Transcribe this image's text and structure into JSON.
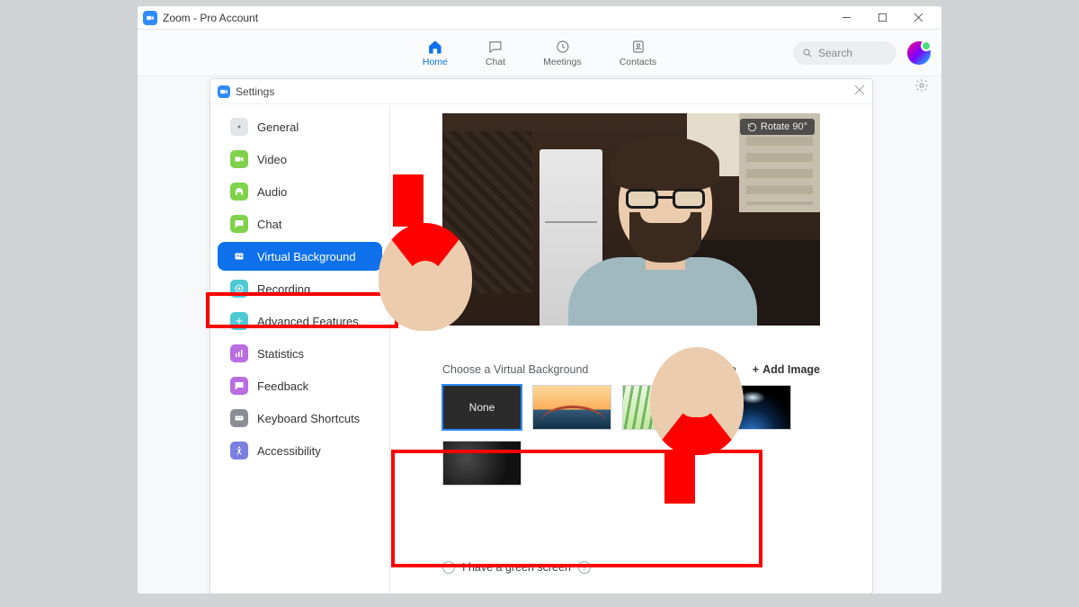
{
  "window": {
    "title": "Zoom - Pro Account"
  },
  "nav": {
    "items": [
      {
        "label": "Home"
      },
      {
        "label": "Chat"
      },
      {
        "label": "Meetings"
      },
      {
        "label": "Contacts"
      }
    ],
    "search_placeholder": "Search"
  },
  "dialog": {
    "title": "Settings",
    "sidebar": [
      {
        "label": "General",
        "icon": "gear-icon",
        "bg": "#e3e5e8",
        "fg": "#7b7f86"
      },
      {
        "label": "Video",
        "icon": "video-icon",
        "bg": "#80d24a"
      },
      {
        "label": "Audio",
        "icon": "headphones-icon",
        "bg": "#80d24a"
      },
      {
        "label": "Chat",
        "icon": "chat-icon",
        "bg": "#80d24a"
      },
      {
        "label": "Virtual Background",
        "icon": "profile-card-icon",
        "bg": "#0e71eb",
        "active": true
      },
      {
        "label": "Recording",
        "icon": "record-icon",
        "bg": "#4ec9d4"
      },
      {
        "label": "Advanced Features",
        "icon": "plus-icon",
        "bg": "#4ec9d4"
      },
      {
        "label": "Statistics",
        "icon": "stats-icon",
        "bg": "#b96ee0"
      },
      {
        "label": "Feedback",
        "icon": "feedback-icon",
        "bg": "#b96ee0"
      },
      {
        "label": "Keyboard Shortcuts",
        "icon": "keyboard-icon",
        "bg": "#8a8d94"
      },
      {
        "label": "Accessibility",
        "icon": "accessibility-icon",
        "bg": "#7a7fe0"
      }
    ],
    "preview": {
      "rotate_label": "Rotate 90°"
    },
    "section_label": "Choose a Virtual Background",
    "actions": {
      "remove": "Remove",
      "add": "Add Image"
    },
    "thumbs": [
      {
        "kind": "none",
        "label": "None",
        "selected": true
      },
      {
        "kind": "bridge"
      },
      {
        "kind": "grass"
      },
      {
        "kind": "earth"
      },
      {
        "kind": "dark"
      }
    ],
    "green_screen_label": "I have a green screen"
  }
}
